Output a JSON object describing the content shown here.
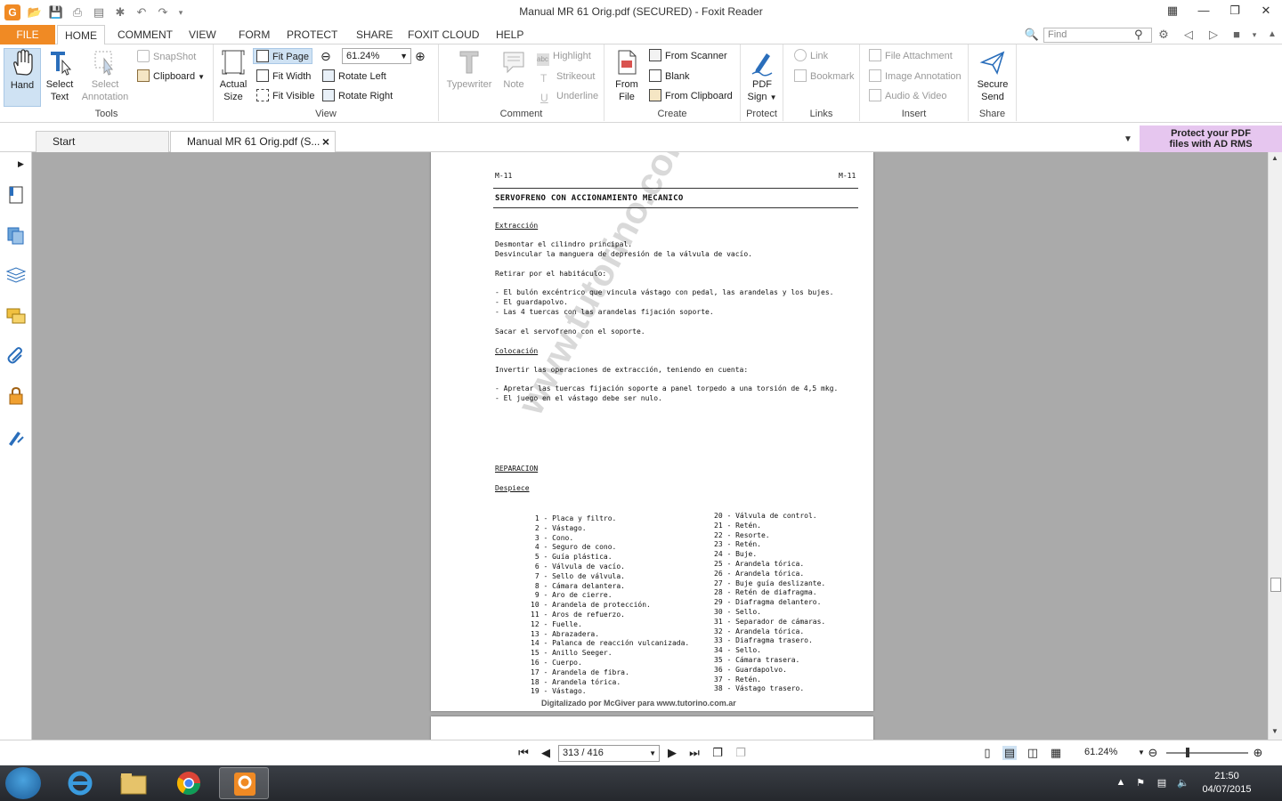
{
  "window": {
    "title": "Manual MR 61 Orig.pdf (SECURED) - Foxit Reader",
    "logo": "G"
  },
  "menu": {
    "file": "FILE",
    "tabs": [
      "HOME",
      "COMMENT",
      "VIEW",
      "FORM",
      "PROTECT",
      "SHARE",
      "FOXIT CLOUD",
      "HELP"
    ],
    "find_placeholder": "Find"
  },
  "ribbon": {
    "tools": {
      "label": "Tools",
      "hand": "Hand",
      "select_text": "Select Text",
      "select_annotation": "Select Annotation",
      "snapshot": "SnapShot",
      "clipboard": "Clipboard"
    },
    "view": {
      "label": "View",
      "actual_size": "Actual Size",
      "fit_page": "Fit Page",
      "fit_width": "Fit Width",
      "fit_visible": "Fit Visible",
      "zoom": "61.24%",
      "rotate_left": "Rotate Left",
      "rotate_right": "Rotate Right"
    },
    "comment": {
      "label": "Comment",
      "typewriter": "Typewriter",
      "note": "Note",
      "highlight": "Highlight",
      "strikeout": "Strikeout",
      "underline": "Underline"
    },
    "create": {
      "label": "Create",
      "from_file": "From File",
      "from_scanner": "From Scanner",
      "blank": "Blank",
      "from_clipboard": "From Clipboard"
    },
    "protect": {
      "label": "Protect",
      "pdf_sign": "PDF Sign"
    },
    "links": {
      "label": "Links",
      "link": "Link",
      "bookmark": "Bookmark"
    },
    "insert": {
      "label": "Insert",
      "file_attachment": "File Attachment",
      "image_annotation": "Image Annotation",
      "audio_video": "Audio & Video"
    },
    "share": {
      "label": "Share",
      "secure_send": "Secure Send"
    }
  },
  "doc_tabs": [
    {
      "label": "Start"
    },
    {
      "label": "Manual MR 61 Orig.pdf (S..."
    }
  ],
  "promo": {
    "line1": "Protect your PDF",
    "line2": "files with AD RMS"
  },
  "page": {
    "header_left": "M-11",
    "header_right": "M-11",
    "title": "SERVOFRENO CON ACCIONAMIENTO MECANICO",
    "s1_heading": "Extracción",
    "s1_lines": [
      "Desmontar el cilindro principal.",
      "Desvincular la manguera de depresión de la válvula de vacío.",
      "Retirar por el habitáculo:",
      "- El bulón excéntrico que vincula vástago con pedal, las arandelas y los bujes.",
      "- El guardapolvo.",
      "- Las 4 tuercas con las arandelas fijación soporte.",
      "Sacar el servofreno con el soporte."
    ],
    "s2_heading": "Colocación",
    "s2_lines": [
      "Invertir las operaciones de extracción, teniendo en cuenta:",
      "- Apretar las tuercas fijación soporte a panel torpedo a una torsión de 4,5 mkg.",
      "- El juego en el vástago debe ser nulo."
    ],
    "s3_heading": "REPARACION",
    "s3_sub": "Despiece",
    "parts_left": [
      " 1 - Placa y filtro.",
      " 2 - Vástago.",
      " 3 - Cono.",
      " 4 - Seguro de cono.",
      " 5 - Guía plástica.",
      " 6 - Válvula de vacío.",
      " 7 - Sello de válvula.",
      " 8 - Cámara delantera.",
      " 9 - Aro de cierre.",
      "10 - Arandela de protección.",
      "11 - Aros de refuerzo.",
      "12 - Fuelle.",
      "13 - Abrazadera.",
      "14 - Palanca de reacción vulcanizada.",
      "15 - Anillo Seeger.",
      "16 - Cuerpo.",
      "17 - Arandela de fibra.",
      "18 - Arandela tórica.",
      "19 - Vástago."
    ],
    "parts_right": [
      "20 - Válvula de control.",
      "21 - Retén.",
      "22 - Resorte.",
      "23 - Retén.",
      "24 - Buje.",
      "25 - Arandela tórica.",
      "26 - Arandela tórica.",
      "27 - Buje guía deslizante.",
      "28 - Retén de diafragma.",
      "29 - Diafragma delantero.",
      "30 - Sello.",
      "31 - Separador de cámaras.",
      "32 - Arandela tórica.",
      "33 - Diafragma trasero.",
      "34 - Sello.",
      "35 - Cámara trasera.",
      "36 - Guardapolvo.",
      "37 - Retén.",
      "38 - Vástago trasero."
    ],
    "footer": "Digitalizado por McGiver para www.tutorino.com.ar",
    "watermark": "www.tutorino.com.ar"
  },
  "status": {
    "page_indicator": "313 / 416",
    "zoom": "61.24%"
  },
  "taskbar": {
    "time": "21:50",
    "date": "04/07/2015"
  },
  "colors": {
    "accent": "#f08a24",
    "selected": "#cfe2f3",
    "promo": "#e6c6ef",
    "canvas": "#aaaaaa"
  }
}
